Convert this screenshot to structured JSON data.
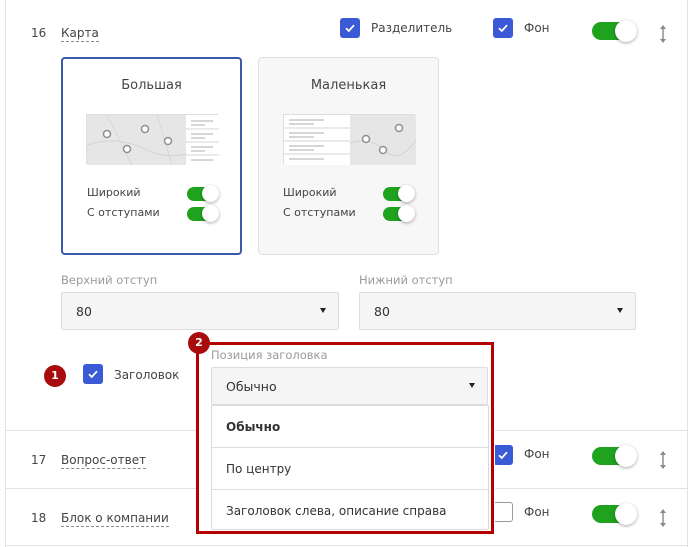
{
  "rows": [
    {
      "number": "16",
      "link": "Карта"
    },
    {
      "number": "17",
      "link": "Вопрос-ответ"
    },
    {
      "number": "18",
      "link": "Блок о компании"
    }
  ],
  "row16": {
    "separator_label": "Разделитель",
    "background_label": "Фон"
  },
  "row17": {
    "background_label": "Фон"
  },
  "row18": {
    "background_label": "Фон"
  },
  "cards": [
    {
      "title": "Большая",
      "wide_label": "Широкий",
      "padding_label": "С отступами"
    },
    {
      "title": "Маленькая",
      "wide_label": "Широкий",
      "padding_label": "С отступами"
    }
  ],
  "top_padding": {
    "label": "Верхний отступ",
    "value": "80"
  },
  "bottom_padding": {
    "label": "Нижний отступ",
    "value": "80"
  },
  "heading": {
    "label": "Заголовок"
  },
  "heading_position": {
    "label": "Позиция заголовка",
    "value": "Обычно",
    "options": [
      "Обычно",
      "По центру",
      "Заголовок слева, описание справа"
    ]
  },
  "badges": [
    "1",
    "2"
  ],
  "colors": {
    "accent": "#3b5bd6",
    "toggle_on": "#1fa31f",
    "highlight": "#b40000",
    "badge": "#a80c0c"
  }
}
